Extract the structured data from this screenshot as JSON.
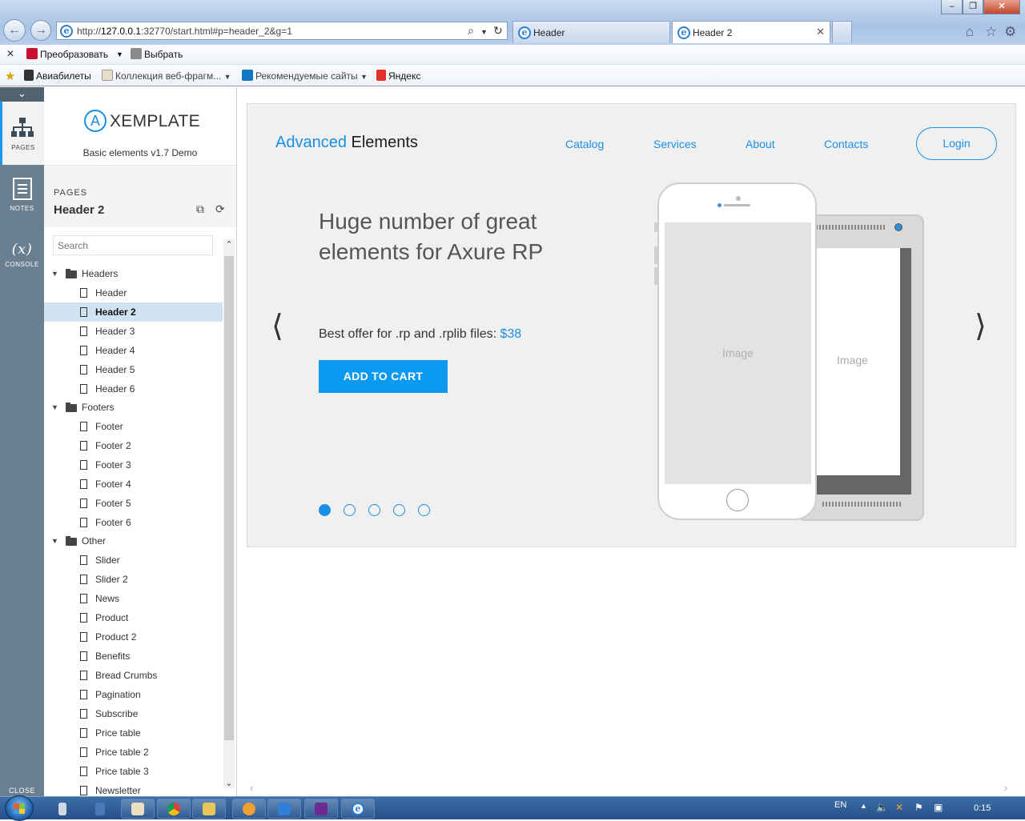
{
  "browser": {
    "url_prefix": "http://",
    "url_host": "127.0.0.1",
    "url_rest": ":32770/start.html#p=header_2&g=1",
    "tabs": [
      {
        "label": "Header"
      },
      {
        "label": "Header 2"
      }
    ],
    "toolbar1": {
      "convert": "Преобразовать",
      "select": "Выбрать"
    },
    "favorites": [
      {
        "label": "Авиабилеты"
      },
      {
        "label": "Коллекция веб-фрагм..."
      },
      {
        "label": "Рекомендуемые сайты"
      },
      {
        "label": "Яндекс"
      }
    ]
  },
  "rail": {
    "pages": "PAGES",
    "notes": "NOTES",
    "console_icon": "(x)",
    "console": "CONSOLE",
    "close": "CLOSE"
  },
  "sidebar": {
    "logo_letter": "A",
    "logo_name": "XEMPLATE",
    "subtitle": "Basic elements v1.7 Demo",
    "pages_caption": "PAGES",
    "current_page": "Header 2",
    "search_placeholder": "Search",
    "tree": [
      {
        "type": "folder",
        "label": "Headers"
      },
      {
        "type": "page",
        "label": "Header"
      },
      {
        "type": "page",
        "label": "Header 2",
        "selected": true
      },
      {
        "type": "page",
        "label": "Header 3"
      },
      {
        "type": "page",
        "label": "Header 4"
      },
      {
        "type": "page",
        "label": "Header 5"
      },
      {
        "type": "page",
        "label": "Header 6"
      },
      {
        "type": "folder",
        "label": "Footers"
      },
      {
        "type": "page",
        "label": "Footer"
      },
      {
        "type": "page",
        "label": "Footer 2"
      },
      {
        "type": "page",
        "label": "Footer 3"
      },
      {
        "type": "page",
        "label": "Footer 4"
      },
      {
        "type": "page",
        "label": "Footer 5"
      },
      {
        "type": "page",
        "label": "Footer 6"
      },
      {
        "type": "folder",
        "label": "Other"
      },
      {
        "type": "page",
        "label": "Slider"
      },
      {
        "type": "page",
        "label": "Slider 2"
      },
      {
        "type": "page",
        "label": "News"
      },
      {
        "type": "page",
        "label": "Product"
      },
      {
        "type": "page",
        "label": "Product 2"
      },
      {
        "type": "page",
        "label": "Benefits"
      },
      {
        "type": "page",
        "label": "Bread Crumbs"
      },
      {
        "type": "page",
        "label": "Pagination"
      },
      {
        "type": "page",
        "label": "Subscribe"
      },
      {
        "type": "page",
        "label": "Price table"
      },
      {
        "type": "page",
        "label": "Price table 2"
      },
      {
        "type": "page",
        "label": "Price table 3"
      },
      {
        "type": "page",
        "label": "Newsletter"
      }
    ]
  },
  "hero": {
    "brand_accent": "Advanced",
    "brand_rest": " Elements",
    "nav": [
      "Catalog",
      "Services",
      "About",
      "Contacts"
    ],
    "login": "Login",
    "headline": "Huge number of great elements for Axure RP",
    "offer_text": "Best offer for .rp and .rplib files: ",
    "offer_price": "$38",
    "cta": "ADD TO CART",
    "image_label_front": "Image",
    "image_label_back": "Image",
    "slides_total": 5,
    "slide_active": 1,
    "accent_color": "#1a8fe6"
  },
  "taskbar": {
    "lang": "EN",
    "clock": "0:15"
  }
}
